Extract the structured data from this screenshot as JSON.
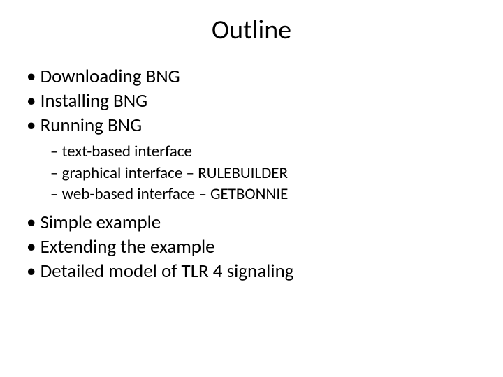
{
  "title": "Outline",
  "bullets_top": [
    "Downloading BNG",
    "Installing BNG",
    "Running BNG"
  ],
  "subbullets": [
    "text-based interface",
    "graphical interface – RULEBUILDER",
    "web-based interface – GETBONNIE"
  ],
  "bullets_bottom": [
    "Simple example",
    "Extending the example",
    "Detailed model of TLR 4 signaling"
  ]
}
